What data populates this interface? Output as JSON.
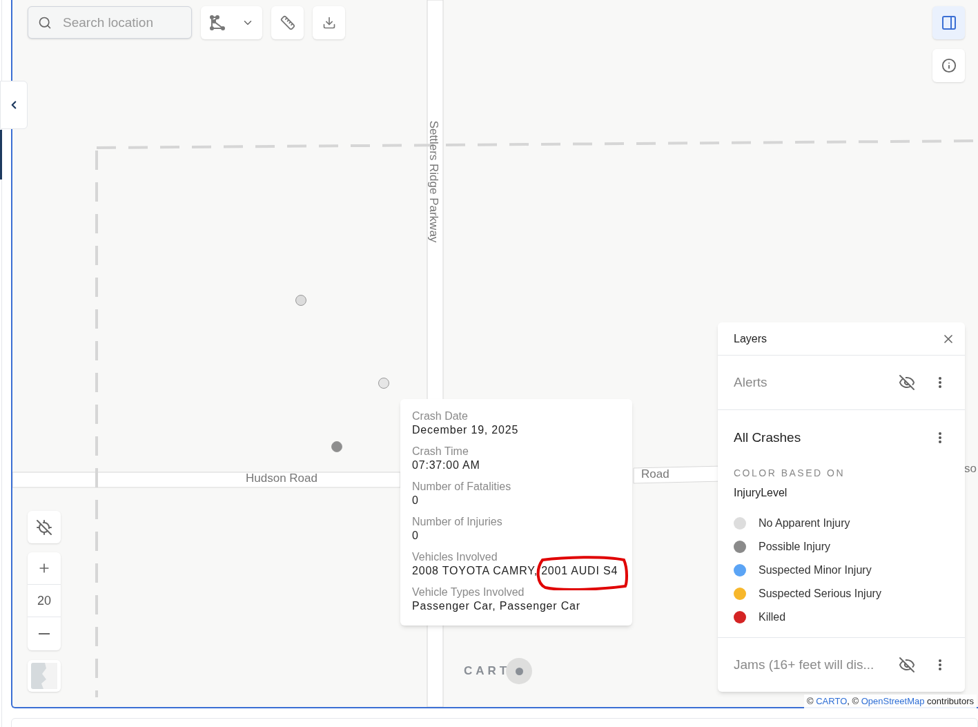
{
  "search": {
    "placeholder": "Search location"
  },
  "layers_toggle": {
    "selected": true
  },
  "map": {
    "road_labels": [
      {
        "text": "Settlers Ridge Parkway",
        "kind": "vertical"
      },
      {
        "text": "Hudson Road",
        "kind": "horizontal"
      },
      {
        "text": "Road",
        "kind": "horizontal"
      },
      {
        "text": "so",
        "kind": "horizontal"
      }
    ],
    "points": [
      {
        "color": "#dcdcdc"
      },
      {
        "color": "#e6e6e6"
      },
      {
        "color": "#8e8e8e"
      }
    ]
  },
  "popup": {
    "fields": [
      {
        "label": "Crash Date",
        "value": "December 19, 2025"
      },
      {
        "label": "Crash Time",
        "value": "07:37:00 AM"
      },
      {
        "label": "Number of Fatalities",
        "value": "0"
      },
      {
        "label": "Number of Injuries",
        "value": "0"
      },
      {
        "label": "Vehicles Involved",
        "value": "2008 TOYOTA CAMRY, 2001 AUDI S4"
      },
      {
        "label": "Vehicle Types Involved",
        "value": "Passenger Car, Passenger Car"
      }
    ]
  },
  "zoom": {
    "level_text": "20"
  },
  "carto_logo": "CART",
  "layers_panel": {
    "title": "Layers",
    "layers": [
      {
        "name": "Alerts",
        "visible": false
      },
      {
        "name": "All Crashes",
        "visible": true,
        "legend": {
          "heading": "COLOR BASED ON",
          "field": "InjuryLevel",
          "items": [
            {
              "label": "No Apparent Injury",
              "color": "#dddddd"
            },
            {
              "label": "Possible Injury",
              "color": "#8a8a8a"
            },
            {
              "label": "Suspected Minor Injury",
              "color": "#5ba4f5"
            },
            {
              "label": "Suspected Serious Injury",
              "color": "#f7b72b"
            },
            {
              "label": "Killed",
              "color": "#d42424"
            }
          ]
        }
      },
      {
        "name": "Jams (16+ feet will dis...",
        "visible": false
      }
    ]
  },
  "attribution": {
    "parts": [
      {
        "text": "© ",
        "kind": "plain"
      },
      {
        "text": "CARTO",
        "kind": "link"
      },
      {
        "text": ", © ",
        "kind": "plain"
      },
      {
        "text": "OpenStreetMap",
        "kind": "link"
      },
      {
        "text": " contributors",
        "kind": "plain"
      }
    ]
  }
}
